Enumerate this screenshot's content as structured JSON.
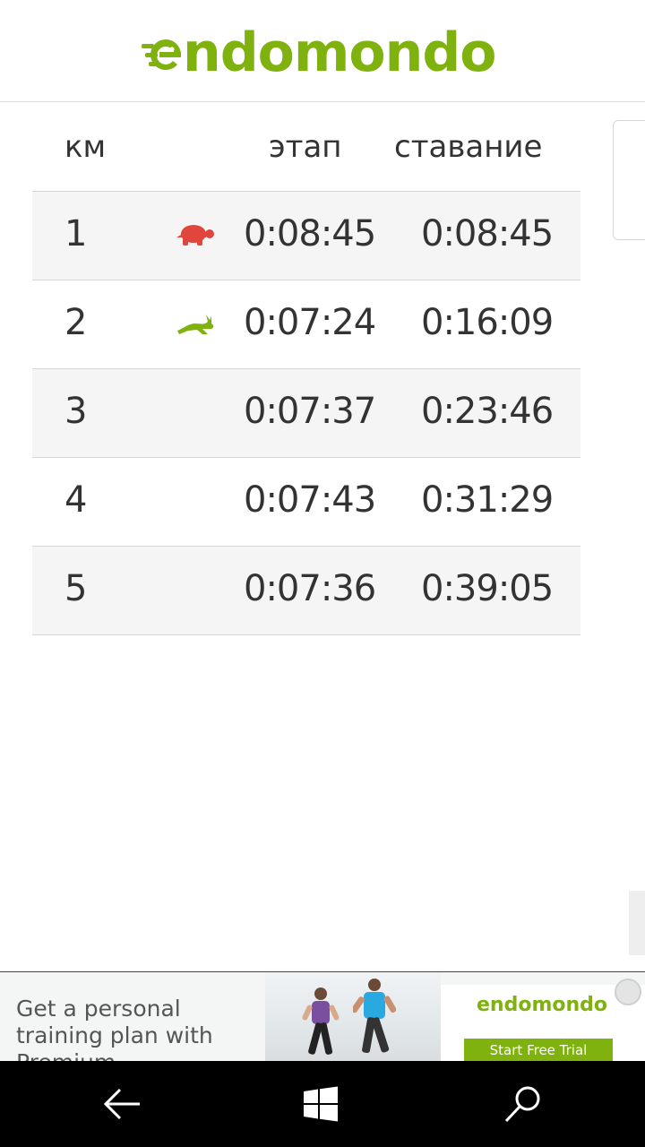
{
  "header": {
    "logo_text": "ndomondo",
    "brand_color": "#7fb10f"
  },
  "table": {
    "columns": {
      "km": "км",
      "leg": "этап",
      "total": "ставание"
    },
    "rows": [
      {
        "km": "1",
        "leg": "0:08:45",
        "total": "0:08:45",
        "icon": "turtle-icon"
      },
      {
        "km": "2",
        "leg": "0:07:24",
        "total": "0:16:09",
        "icon": "rabbit-icon"
      },
      {
        "km": "3",
        "leg": "0:07:37",
        "total": "0:23:46",
        "icon": ""
      },
      {
        "km": "4",
        "leg": "0:07:43",
        "total": "0:31:29",
        "icon": ""
      },
      {
        "km": "5",
        "leg": "0:07:36",
        "total": "0:39:05",
        "icon": ""
      }
    ],
    "slowest_color": "#e0463c",
    "fastest_color": "#7fb10f"
  },
  "ad": {
    "text": "Get a personal training plan with Premium",
    "logo_text": "endomondo",
    "cta": "Start Free Trial"
  },
  "nav": {
    "back_icon": "back-arrow-icon",
    "home_icon": "windows-logo-icon",
    "search_icon": "search-icon"
  }
}
